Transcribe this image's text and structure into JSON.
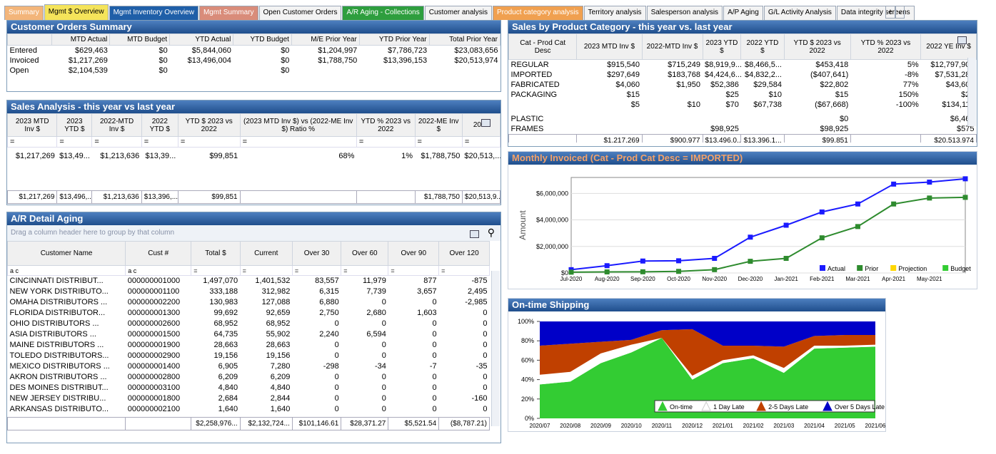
{
  "tabs": [
    {
      "label": "Summary",
      "bg": "#f3b57a",
      "fg": "#ffffff"
    },
    {
      "label": "Mgmt $ Overview",
      "bg": "#f5e45a",
      "fg": "#000000",
      "sel": true
    },
    {
      "label": "Mgmt Inventory Overview",
      "bg": "#1f5fa8",
      "fg": "#ffffff"
    },
    {
      "label": "Mgmt Summary",
      "bg": "#d98c7a",
      "fg": "#ffffff"
    },
    {
      "label": "Open Customer Orders",
      "bg": "#f3f3f3",
      "fg": "#000000"
    },
    {
      "label": "A/R Aging - Collections",
      "bg": "#2e9e3e",
      "fg": "#ffffff"
    },
    {
      "label": "Customer analysis",
      "bg": "#f3f3f3",
      "fg": "#000000"
    },
    {
      "label": "Product category analysis",
      "bg": "#f0a050",
      "fg": "#ffffff"
    },
    {
      "label": "Territory analysis",
      "bg": "#f3f3f3",
      "fg": "#000000"
    },
    {
      "label": "Salesperson analysis",
      "bg": "#f3f3f3",
      "fg": "#000000"
    },
    {
      "label": "A/P Aging",
      "bg": "#f3f3f3",
      "fg": "#000000"
    },
    {
      "label": "G/L Activity Analysis",
      "bg": "#f3f3f3",
      "fg": "#000000"
    },
    {
      "label": "Data integrity screens",
      "bg": "#f3f3f3",
      "fg": "#000000"
    }
  ],
  "cos": {
    "title": "Customer Orders Summary",
    "headers": [
      "",
      "MTD Actual",
      "MTD Budget",
      "YTD Actual",
      "YTD Budget",
      "M/E Prior Year",
      "YTD Prior Year",
      "Total Prior Year"
    ],
    "rows": [
      [
        "Entered",
        "$629,463",
        "$0",
        "$5,844,060",
        "$0",
        "$1,204,997",
        "$7,786,723",
        "$23,083,656"
      ],
      [
        "Invoiced",
        "$1,217,269",
        "$0",
        "$13,496,004",
        "$0",
        "$1,788,750",
        "$13,396,153",
        "$20,513,974"
      ],
      [
        "Open",
        "$2,104,539",
        "$0",
        "",
        "$0",
        "",
        "",
        ""
      ]
    ]
  },
  "sa": {
    "title": "Sales Analysis - this year vs last year",
    "headers": [
      "2023 MTD Inv $",
      "2023 YTD $",
      "2022-MTD Inv $",
      "2022 YTD $",
      "YTD $ 2023 vs 2022",
      "(2023 MTD Inv $) vs (2022-ME Inv $) Ratio %",
      "YTD % 2023 vs 2022",
      "2022-ME Inv $",
      "2022"
    ],
    "row": [
      "$1,217,269",
      "$13,49...",
      "$1,213,636",
      "$13,39...",
      "$99,851",
      "68%",
      "1%",
      "$1,788,750",
      "$20,513,..."
    ],
    "totals": [
      "$1,217,269",
      "$13,496,...",
      "$1,213,636",
      "$13,396,...",
      "$99,851",
      "",
      "",
      "$1,788,750",
      "$20,513,9..."
    ]
  },
  "ar": {
    "title": "A/R Detail Aging",
    "group_hint": "Drag a column header here to group by that column",
    "headers": [
      "Customer Name",
      "Cust #",
      "Total $",
      "Current",
      "Over 30",
      "Over 60",
      "Over 90",
      "Over 120"
    ],
    "rows": [
      [
        "CINCINNATI DISTRIBUT...",
        "000000001000",
        "1,497,070",
        "1,401,532",
        "83,557",
        "11,979",
        "877",
        "-875"
      ],
      [
        "NEW YORK DISTRIBUTO...",
        "000000001100",
        "333,188",
        "312,982",
        "6,315",
        "7,739",
        "3,657",
        "2,495"
      ],
      [
        "OMAHA DISTRIBUTORS ...",
        "000000002200",
        "130,983",
        "127,088",
        "6,880",
        "0",
        "0",
        "-2,985"
      ],
      [
        "FLORIDA DISTRIBUTOR...",
        "000000001300",
        "99,692",
        "92,659",
        "2,750",
        "2,680",
        "1,603",
        "0"
      ],
      [
        "OHIO DISTRIBUTORS ...",
        "000000002600",
        "68,952",
        "68,952",
        "0",
        "0",
        "0",
        "0"
      ],
      [
        "ASIA DISTRIBUTORS ...",
        "000000001500",
        "64,735",
        "55,902",
        "2,240",
        "6,594",
        "0",
        "0"
      ],
      [
        "MAINE DISTRIBUTORS ...",
        "000000001900",
        "28,663",
        "28,663",
        "0",
        "0",
        "0",
        "0"
      ],
      [
        "TOLEDO DISTRIBUTORS...",
        "000000002900",
        "19,156",
        "19,156",
        "0",
        "0",
        "0",
        "0"
      ],
      [
        "MEXICO DISTRIBUTORS ...",
        "000000001400",
        "6,905",
        "7,280",
        "-298",
        "-34",
        "-7",
        "-35"
      ],
      [
        "AKRON DISTRIBUTORS ...",
        "000000002800",
        "6,209",
        "6,209",
        "0",
        "0",
        "0",
        "0"
      ],
      [
        "DES MOINES DISTRIBUT...",
        "000000003100",
        "4,840",
        "4,840",
        "0",
        "0",
        "0",
        "0"
      ],
      [
        "NEW JERSEY DISTRIBU...",
        "000000001800",
        "2,684",
        "2,844",
        "0",
        "0",
        "0",
        "-160"
      ],
      [
        "ARKANSAS DISTRIBUTO...",
        "000000002100",
        "1,640",
        "1,640",
        "0",
        "0",
        "0",
        "0"
      ]
    ],
    "totals": [
      "",
      "",
      "$2,258,976...",
      "$2,132,724...",
      "$101,146.61",
      "$28,371.27",
      "$5,521.54",
      "($8,787.21)"
    ]
  },
  "spc": {
    "title": "Sales by Product Category - this year vs. last year",
    "headers": [
      "Cat - Prod Cat Desc",
      "2023 MTD Inv $",
      "2022-MTD Inv $",
      "2023 YTD $",
      "2022 YTD $",
      "YTD $ 2023 vs 2022",
      "YTD % 2023 vs 2022",
      "2022 YE Inv $"
    ],
    "rows": [
      [
        "REGULAR",
        "$915,540",
        "$715,249",
        "$8,919,9...",
        "$8,466,5...",
        "$453,418",
        "5%",
        "$12,797,904"
      ],
      [
        "IMPORTED",
        "$297,649",
        "$183,768",
        "$4,424,6...",
        "$4,832,2...",
        "($407,641)",
        "-8%",
        "$7,531,280"
      ],
      [
        "FABRICATED",
        "$4,060",
        "$1,950",
        "$52,386",
        "$29,584",
        "$22,802",
        "77%",
        "$43,605"
      ],
      [
        "PACKAGING",
        "$15",
        "",
        "$25",
        "$10",
        "$15",
        "150%",
        "$25"
      ],
      [
        "",
        "$5",
        "$10",
        "$70",
        "$67,738",
        "($67,668)",
        "-100%",
        "$134,117"
      ],
      [
        "PLASTIC",
        "",
        "",
        "",
        "",
        "$0",
        "",
        "$6,468"
      ],
      [
        "FRAMES",
        "",
        "",
        "$98,925",
        "",
        "$98,925",
        "",
        "$575"
      ]
    ],
    "totals": [
      "",
      "$1,217,269",
      "$900,977",
      "$13,496,0...",
      "$13,396,1...",
      "$99,851",
      "",
      "$20,513,974"
    ]
  },
  "mi": {
    "title": "Monthly Invoiced (Cat - Prod Cat Desc = IMPORTED)"
  },
  "os": {
    "title": "On-time Shipping"
  },
  "chart_data": [
    {
      "type": "line",
      "title": "Monthly Invoiced (Cat - Prod Cat Desc = IMPORTED)",
      "ylabel": "Amount",
      "x": [
        "Jul-2020",
        "Aug-2020",
        "Sep-2020",
        "Oct-2020",
        "Nov-2020",
        "Dec-2020",
        "Jan-2021",
        "Feb-2021",
        "Mar-2021",
        "Apr-2021",
        "May-2021",
        ""
      ],
      "xticks": [
        "Jul-2020",
        "Aug-2020",
        "Sep-2020",
        "Oct-2020",
        "Nov-2020",
        "Dec-2020",
        "Jan-2021",
        "Feb-2021",
        "Mar-2021",
        "Apr-2021",
        "May-2021"
      ],
      "yticks": [
        "$0",
        "$2,000,000",
        "$4,000,000",
        "$6,000,000"
      ],
      "ylim": [
        0,
        7200000
      ],
      "series": [
        {
          "name": "Actual",
          "color": "#1a1aff",
          "values": [
            250000,
            550000,
            900000,
            920000,
            1100000,
            2700000,
            3600000,
            4600000,
            5200000,
            6700000,
            6850000,
            7100000
          ]
        },
        {
          "name": "Prior",
          "color": "#2e8b2e",
          "values": [
            60000,
            80000,
            90000,
            120000,
            250000,
            880000,
            1100000,
            2650000,
            3500000,
            5200000,
            5650000,
            5700000
          ]
        },
        {
          "name": "Projection",
          "color": "#ffd700",
          "values": []
        },
        {
          "name": "Budget",
          "color": "#33cc33",
          "values": []
        }
      ],
      "legend": "bottom-right"
    },
    {
      "type": "area",
      "title": "On-time Shipping",
      "x": [
        "2020/07",
        "2020/08",
        "2020/09",
        "2020/10",
        "2020/11",
        "2020/12",
        "2021/01",
        "2021/02",
        "2021/03",
        "2021/04",
        "2021/05",
        "2021/06"
      ],
      "yticks": [
        "0%",
        "20%",
        "40%",
        "60%",
        "80%",
        "100%"
      ],
      "ylim": [
        0,
        100
      ],
      "series": [
        {
          "name": "On-time",
          "color": "#33cc33",
          "values": [
            35,
            38,
            57,
            68,
            83,
            40,
            57,
            62,
            47,
            72,
            73,
            74
          ]
        },
        {
          "name": "1 Day Late",
          "color": "#ffffff",
          "values": [
            10,
            10,
            10,
            8,
            0,
            4,
            3,
            3,
            5,
            3,
            2,
            2
          ]
        },
        {
          "name": "2-5 Days Late",
          "color": "#c04000",
          "values": [
            30,
            29,
            12,
            5,
            8,
            48,
            15,
            10,
            22,
            10,
            11,
            10
          ]
        },
        {
          "name": "Over 5 Days Late",
          "color": "#0000c8",
          "values": [
            25,
            23,
            21,
            19,
            9,
            8,
            25,
            25,
            26,
            15,
            14,
            14
          ]
        }
      ],
      "legend": "bottom"
    }
  ]
}
